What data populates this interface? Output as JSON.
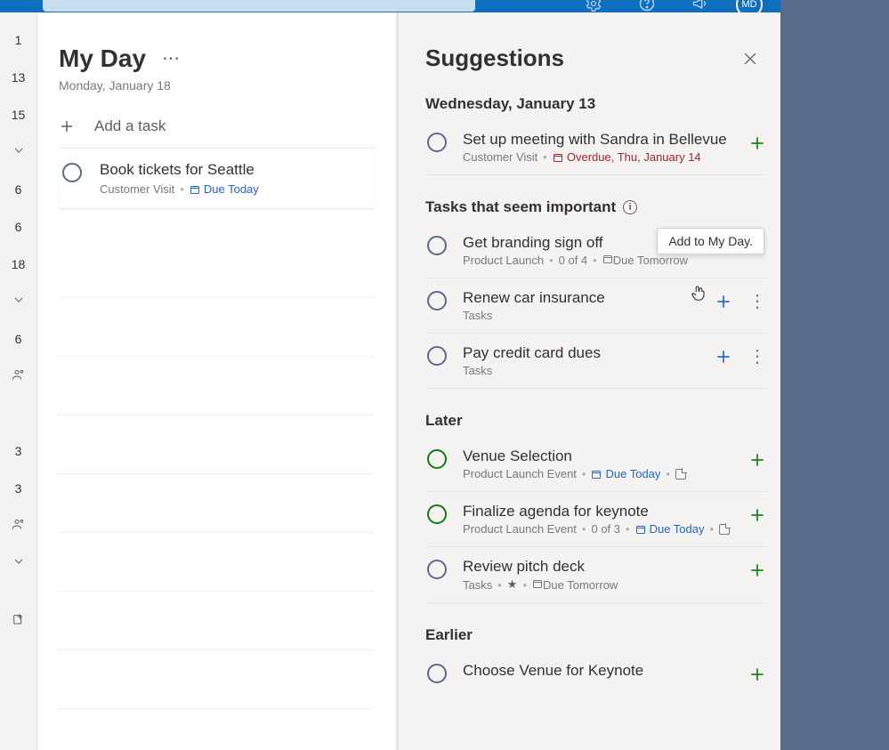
{
  "avatar_initials": "MD",
  "sidebar": {
    "items": [
      "1",
      "13",
      "15",
      "",
      "6",
      "6",
      "18",
      "",
      "6",
      "",
      "",
      "3",
      "3",
      "",
      ""
    ]
  },
  "myday": {
    "title": "My Day",
    "date": "Monday, January 18",
    "add_task_label": "Add a task",
    "task": {
      "title": "Book tickets for Seattle",
      "list": "Customer Visit",
      "due_label": "Due Today"
    }
  },
  "suggestions": {
    "title": "Suggestions",
    "tooltip": "Add to My Day.",
    "groups": [
      {
        "header": "Wednesday, January 13",
        "info": false,
        "items": [
          {
            "title": "Set up meeting with Sandra in Bellevue",
            "list": "Customer Visit",
            "due_label": "Overdue, Thu, January 14",
            "overdue": true,
            "plus_color": "green",
            "show_more": false
          }
        ]
      },
      {
        "header": "Tasks that seem important",
        "info": true,
        "items": [
          {
            "title": "Get branding sign off",
            "list": "Product Launch",
            "steps": "0 of 4",
            "due_label": "Due Tomorrow",
            "plus_color": "gray",
            "show_more": true,
            "hover": true
          },
          {
            "title": "Renew car insurance",
            "list": "Tasks",
            "plus_color": "blue",
            "show_more": true
          },
          {
            "title": "Pay credit card dues",
            "list": "Tasks",
            "plus_color": "blue",
            "show_more": true
          }
        ]
      },
      {
        "header": "Later",
        "info": false,
        "items": [
          {
            "title": "Venue Selection",
            "list": "Product Launch Event",
            "due_label": "Due Today",
            "due_blue": true,
            "note": true,
            "radio_green": true,
            "plus_color": "green",
            "show_more": false
          },
          {
            "title": "Finalize agenda for keynote",
            "list": "Product Launch Event",
            "steps": "0 of 3",
            "due_label": "Due Today",
            "due_blue": true,
            "note": true,
            "radio_green": true,
            "plus_color": "green",
            "show_more": false
          },
          {
            "title": "Review pitch deck",
            "list": "Tasks",
            "star": true,
            "due_label": "Due Tomorrow",
            "plus_color": "green",
            "show_more": false
          }
        ]
      },
      {
        "header": "Earlier",
        "info": false,
        "items": [
          {
            "title": "Choose Venue for Keynote",
            "list": "",
            "plus_color": "green",
            "show_more": false
          }
        ]
      }
    ]
  }
}
